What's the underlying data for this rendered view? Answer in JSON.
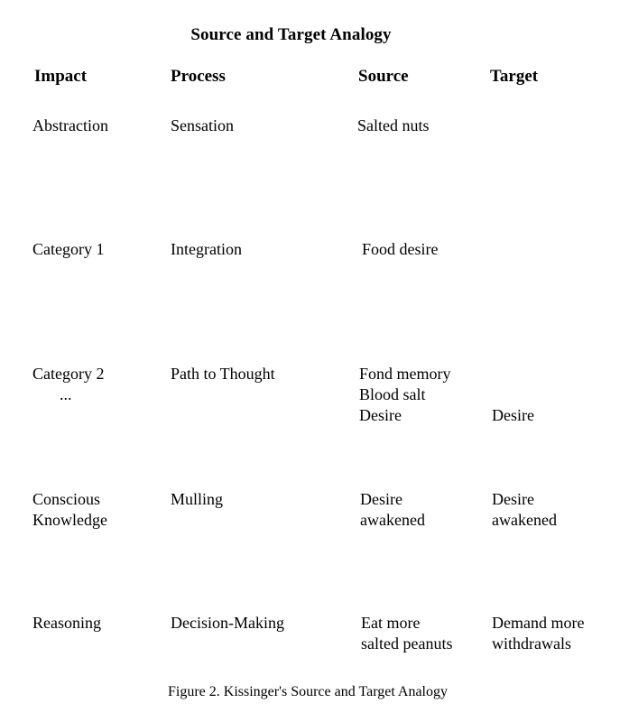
{
  "figure": {
    "title": "Source and Target Analogy",
    "caption": "Figure 2. Kissinger's Source and Target Analogy",
    "columns": [
      {
        "key": "impact",
        "label": "Impact"
      },
      {
        "key": "process",
        "label": "Process"
      },
      {
        "key": "source",
        "label": "Source"
      },
      {
        "key": "target",
        "label": "Target"
      }
    ],
    "rows": [
      {
        "impact": "Abstraction",
        "process": "Sensation",
        "source": "Salted nuts",
        "target": ""
      },
      {
        "impact": "Category 1",
        "process": "Integration",
        "source": "Food desire",
        "target": ""
      },
      {
        "impact": "Category 2",
        "impact_continuation": "...",
        "process": "Path to Thought",
        "source": "Fond memory\nBlood salt\nDesire",
        "target": "Desire"
      },
      {
        "impact": "Conscious\nKnowledge",
        "process": "Mulling",
        "source": "Desire\nawakened",
        "target": "Desire\nawakened"
      },
      {
        "impact": "Reasoning",
        "process": "Decision-Making",
        "source": "Eat more\nsalted peanuts",
        "target": "Demand more\nwithdrawals"
      }
    ]
  },
  "colors": {
    "background": "#ffffff",
    "text": "#000000"
  }
}
